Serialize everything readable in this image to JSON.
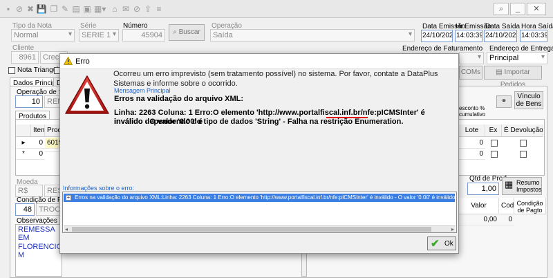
{
  "header": {
    "tipo_nota_label": "Tipo da Nota",
    "tipo_nota_value": "Normal",
    "serie_label": "Série",
    "serie_value": "SERIE 1",
    "numero_label": "Número",
    "numero_value": "45904",
    "buscar_label": "Buscar",
    "operacao_label": "Operação",
    "operacao_value": "Saída",
    "data_emissao_label": "Data Emissão",
    "data_emissao_value": "24/10/2024",
    "hr_emissao_label": "Hr Emissão",
    "hr_emissao_value": "14:03:39",
    "data_saida_label": "Data Saída",
    "data_saida_value": "24/10/2024",
    "hora_saida_label": "Hora Saída",
    "hora_saida_value": "14:03:39"
  },
  "client": {
    "cliente_label": "Cliente",
    "cliente_code": "8961",
    "cliente_name": "Crech",
    "endereco_fat_label": "Endereço de Faturamento",
    "endereco_ent_label": "Endereço de Entrega",
    "endereco_ent_value": "Principal",
    "nota_triangular_label": "Nota Triangular",
    "nota_triangular_short": "I",
    "comis_label": "COMs",
    "importar_pedidos_label": "Importar Pedidos"
  },
  "tabs": {
    "dados_principais": "Dados Principais",
    "second_tab": "D"
  },
  "operacao": {
    "label": "Operação de Saíd",
    "code": "10",
    "value": "REM",
    "vinculo_bens": "Vínculo de Bens",
    "desconto_label": "esconto % cumulativo"
  },
  "produtos": {
    "tab_label": "Produtos",
    "columns": [
      "Item",
      "Produ"
    ],
    "rows": [
      {
        "marker": "▸",
        "item": "0",
        "produto": "6019"
      },
      {
        "marker": "*",
        "item": "0",
        "produto": ""
      }
    ],
    "right_columns": [
      "Lote",
      "Ex",
      "É Devolução"
    ],
    "right_rows": [
      {
        "lote": "0"
      },
      {
        "lote": "0"
      }
    ]
  },
  "bottom": {
    "moeda_label": "Moeda",
    "moeda_value": "R$",
    "resumo_value": "RESUMO",
    "qtd_prod_label": "Qtd de Prod.",
    "qtd_prod_value": "1,00",
    "resumo_impostos_label": "Resumo Impostos",
    "condicao_label": "Condição de Pagar",
    "condicao_code": "48",
    "condicao_value": "TROCA",
    "observacoes_label": "Observações do P",
    "obs_line1": "REMESSA EM",
    "obs_line2": "FLORENCIO M",
    "valor_label": "Valor",
    "cod_label": "Cod",
    "condicao_pagto_label": "Condição de Pagto",
    "valor_value": "0,00",
    "cod_value": "0"
  },
  "dialog": {
    "title": "Erro",
    "message": "Ocorreu um erro imprevisto (sem tratamento possível) no sistema. Por favor, contate a DataPlus Sistemas e informe sobre o ocorrido.",
    "mensagem_principal_label": "Mensagem Principal",
    "erros_title": "Erros na validação do arquivo XML:",
    "erro_line1": "Linha: 2263 Coluna: 1 Erro:O elemento 'http://www.portalfiscal.inf.br/nfe:pICMSInter' é inválido - O valor '0.00' é",
    "erro_line2": "inválido dependendo do tipo de dados 'String' - Falha na restrição Enumeration.",
    "info_label": "Informações sobre o erro:",
    "info_row": "Erros na validação do arquivo XML:Linha: 2263 Coluna: 1 Erro:O elemento 'http://www.portalfiscal.inf.br/nfe:pICMSInter' é inválido - O valor '0.00' é inválido dependendo do ti",
    "ok_label": "Ok"
  },
  "colors": {
    "accent_blue": "#1c63c8",
    "selection_blue": "#3a7ee3",
    "error_red": "#c8201c",
    "ok_green": "#3aa62a"
  }
}
